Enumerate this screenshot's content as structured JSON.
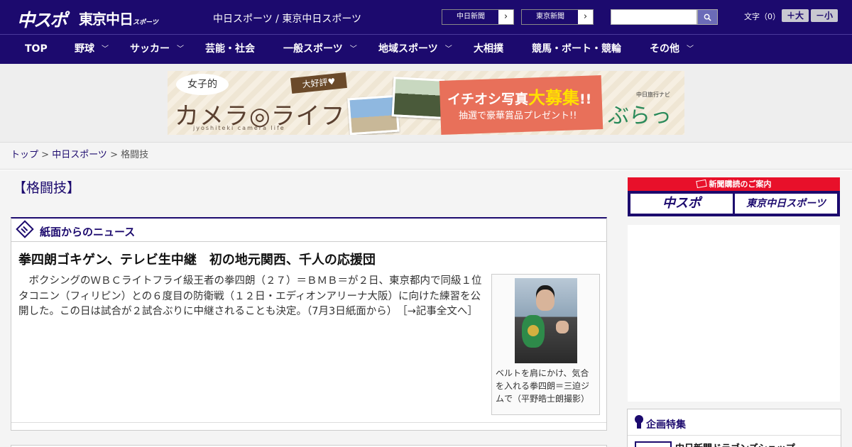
{
  "header": {
    "logo_chunichi": "中スポ",
    "logo_tokyo": "東京中日",
    "logo_tokyo_small": "スポーツ",
    "site_title": "中日スポーツ / 東京中日スポーツ",
    "paper_buttons": [
      {
        "label": "中日新聞",
        "arrow": "›"
      },
      {
        "label": "東京新聞",
        "arrow": "›"
      }
    ],
    "search_placeholder": "",
    "search_icon": "search-icon",
    "font_size_label": "文字（0）",
    "font_larger": "＋大",
    "font_smaller": "－小"
  },
  "nav": {
    "items": [
      {
        "label": "TOP",
        "has_dropdown": false
      },
      {
        "label": "野球",
        "has_dropdown": true
      },
      {
        "label": "サッカー",
        "has_dropdown": true
      },
      {
        "label": "芸能・社会",
        "has_dropdown": false
      },
      {
        "label": "一般スポーツ",
        "has_dropdown": true
      },
      {
        "label": "地域スポーツ",
        "has_dropdown": true
      },
      {
        "label": "大相撲",
        "has_dropdown": false
      },
      {
        "label": "競馬・ボート・競輪",
        "has_dropdown": false
      },
      {
        "label": "その他",
        "has_dropdown": true
      }
    ],
    "chevron": "﹀"
  },
  "banner": {
    "joshi": "女子的",
    "daisuki": "大好評♥",
    "camera_life": "カメラ◎ライフ",
    "sub": "jyoshiteki camera life",
    "ichioshi": "イチオシ写真",
    "ichioshi_big": "大募集",
    "ichioshi_end": "!!",
    "present": "抽選で豪華賞品プレゼント!!",
    "nabi": "中日旅行ナビ",
    "burattu": "ぶらっ人"
  },
  "breadcrumb": {
    "home": "トップ",
    "sep": " > ",
    "section": "中日スポーツ",
    "current": "格闘技"
  },
  "page": {
    "heading": "【格闘技】"
  },
  "news_panel": {
    "title": "紙面からのニュース",
    "article": {
      "title": "拳四朗ゴキゲン、テレビ生中継　初の地元関西、千人の応援団",
      "body": "　ボクシングのＷＢＣライトフライ級王者の拳四朗（２７）＝ＢＭＢ＝が２日、東京都内で同級１位タコニン（フィリピン）との６度目の防衛戦（１２日・エディオンアリーナ大阪）に向けた練習を公開した。この日は試合が２試合ぶりに中継されることも決定。（7月3日紙面から）　",
      "more": "［→記事全文へ］",
      "caption": "ベルトを肩にかけ、気合を入れる拳四朗＝三迫ジムで（平野皓士朗撮影）"
    }
  },
  "sidebar": {
    "subscribe_label": "新聞購読のご案内",
    "subscribe_chunichi": "中スポ",
    "subscribe_tokyo": "東京中日スポーツ",
    "feature_title": "企画特集",
    "feature_item": "中日新聞ドラゴンズショップ"
  },
  "colors": {
    "brand_navy": "#1c0a6e",
    "subscribe_red": "#e8102a"
  }
}
